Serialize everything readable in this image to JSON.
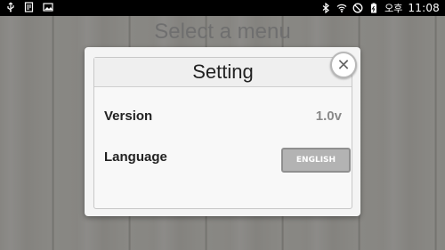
{
  "status_bar": {
    "left_icons": [
      "usb-icon",
      "document-icon",
      "image-icon"
    ],
    "right_icons": [
      "bluetooth-icon",
      "wifi-icon",
      "blocked-icon",
      "battery-icon"
    ],
    "ampm": "오후",
    "time": "11:08"
  },
  "page": {
    "title": "Select a menu"
  },
  "dialog": {
    "title": "Setting",
    "rows": [
      {
        "label": "Version",
        "value": "1.0v"
      },
      {
        "label": "Language",
        "button": "ENGLISH"
      }
    ]
  },
  "colors": {
    "status_bar": "#000000",
    "dialog_bg": "#f4f4f4",
    "language_button": "#b3b3b3"
  }
}
